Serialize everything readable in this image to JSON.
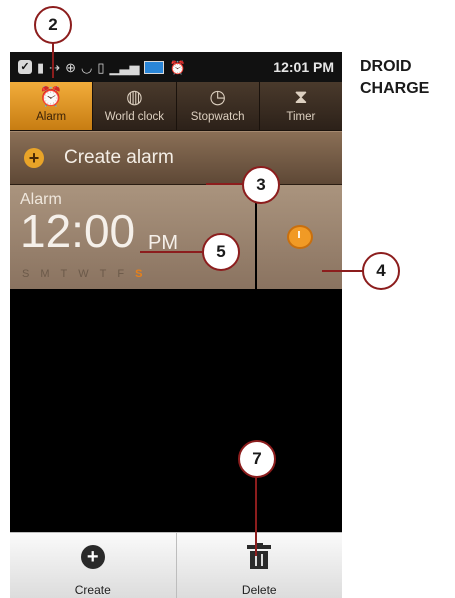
{
  "status_bar": {
    "time": "12:01 PM",
    "icons": [
      "check-icon",
      "clipboard-icon",
      "usb-icon",
      "gps-icon",
      "wifi-icon",
      "vibrate-icon",
      "signal-icon",
      "battery-icon",
      "alarm-status-icon"
    ]
  },
  "tabs": [
    {
      "label": "Alarm",
      "icon": "alarm-icon",
      "active": true
    },
    {
      "label": "World clock",
      "icon": "globe-icon",
      "active": false
    },
    {
      "label": "Stopwatch",
      "icon": "stopwatch-icon",
      "active": false
    },
    {
      "label": "Timer",
      "icon": "hourglass-icon",
      "active": false
    }
  ],
  "create_bar": {
    "plus_glyph": "+",
    "label": "Create alarm"
  },
  "alarm": {
    "title": "Alarm",
    "time": "12:00",
    "ampm": "PM",
    "days": [
      "S",
      "M",
      "T",
      "W",
      "T",
      "F",
      "S"
    ],
    "active_day_index": 6
  },
  "bottom_bar": {
    "create_label": "Create",
    "create_glyph": "+",
    "delete_label": "Delete"
  },
  "side_title": {
    "line1": "DROID",
    "line2": "CHARGE"
  },
  "callouts": {
    "c2": "2",
    "c3": "3",
    "c4": "4",
    "c5": "5",
    "c7": "7"
  },
  "colors": {
    "accent": "#f2ad3b",
    "callout": "#8c1d1d",
    "active_day": "#e8801a"
  }
}
